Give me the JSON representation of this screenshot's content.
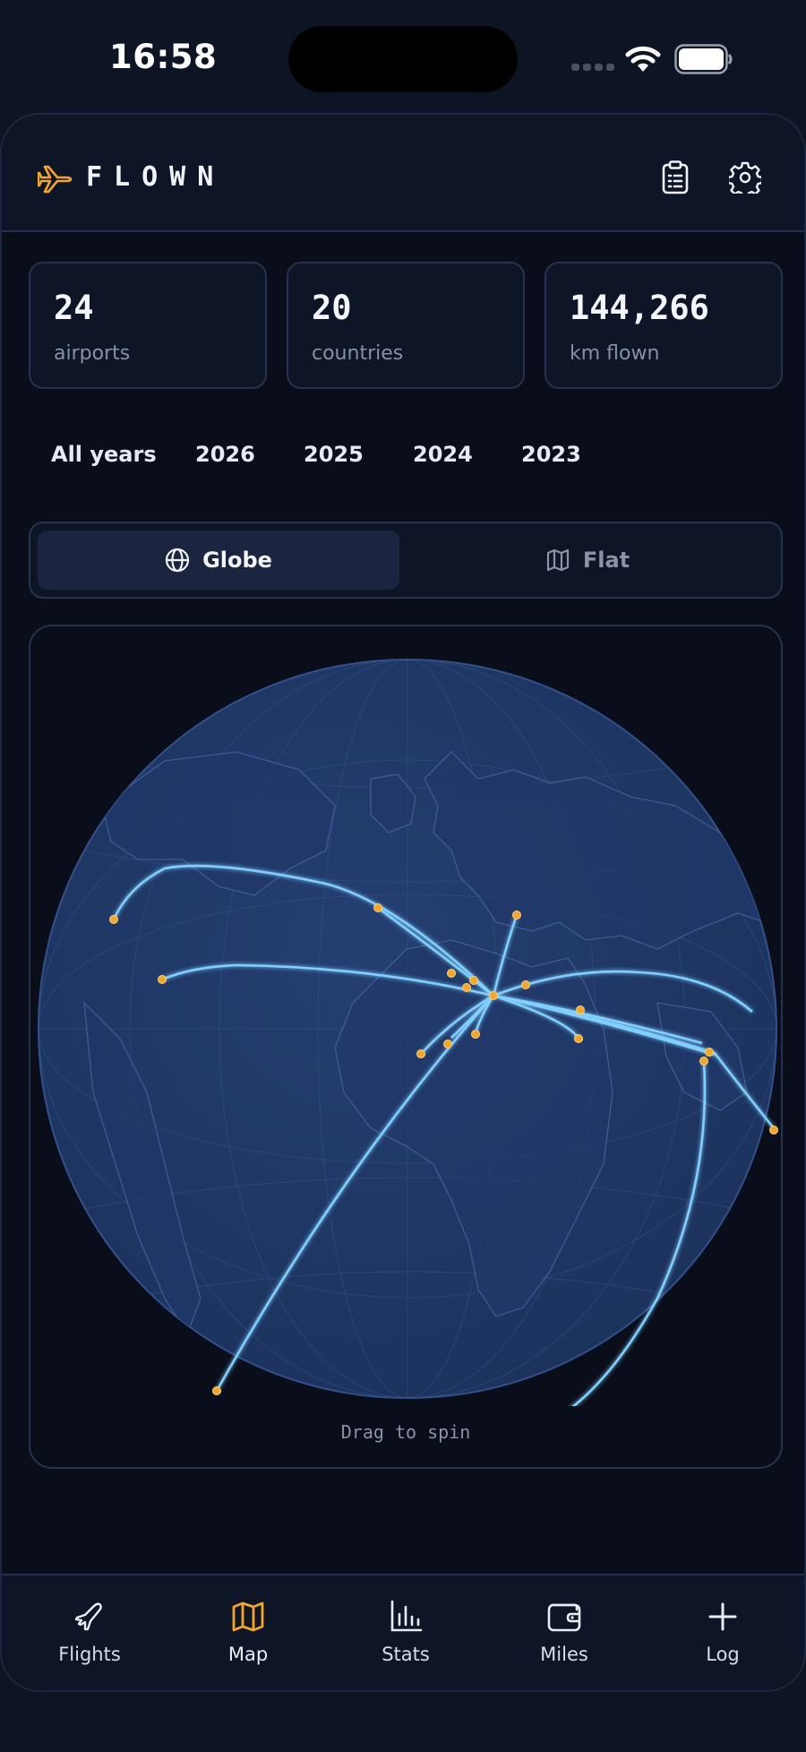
{
  "status_bar": {
    "time": "16:58"
  },
  "app": {
    "title": "FLOWN"
  },
  "stats": [
    {
      "value": "24",
      "label": "airports"
    },
    {
      "value": "20",
      "label": "countries"
    },
    {
      "value": "144,266",
      "label": "km flown"
    }
  ],
  "year_filters": [
    {
      "label": "All years",
      "selected": true
    },
    {
      "label": "2026",
      "selected": false
    },
    {
      "label": "2025",
      "selected": false
    },
    {
      "label": "2024",
      "selected": false
    },
    {
      "label": "2023",
      "selected": false
    }
  ],
  "view_toggle": {
    "globe_label": "Globe",
    "flat_label": "Flat",
    "selected": "Globe"
  },
  "map": {
    "hint": "Drag to spin"
  },
  "tabs": [
    {
      "label": "Flights",
      "icon": "plane-icon",
      "active": false
    },
    {
      "label": "Map",
      "icon": "map-icon",
      "active": true
    },
    {
      "label": "Stats",
      "icon": "bar-chart-icon",
      "active": false
    },
    {
      "label": "Miles",
      "icon": "wallet-icon",
      "active": false
    },
    {
      "label": "Log",
      "icon": "plus-icon",
      "active": false
    }
  ],
  "colors": {
    "accent": "#f5a623",
    "route_line": "#7fd0ff",
    "globe_fill": "#203a6b",
    "background": "#0a0e1a"
  }
}
